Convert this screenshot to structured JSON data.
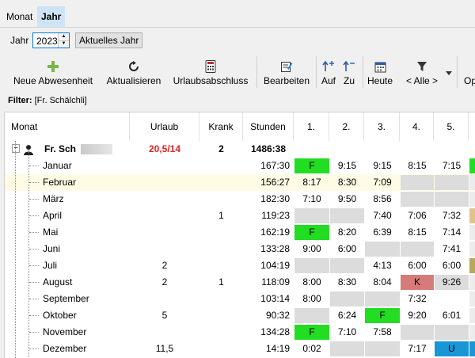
{
  "tabs": [
    {
      "label": "Monat"
    },
    {
      "label": "Jahr"
    }
  ],
  "year": {
    "label": "Jahr",
    "value": "2023",
    "button": "Aktuelles Jahr"
  },
  "toolbar": {
    "neue": "Neue Abwesenheit",
    "aktualisieren": "Aktualisieren",
    "urlaubsabschluss": "Urlaubsabschluss",
    "bearbeiten": "Bearbeiten",
    "auf": "Auf",
    "zu": "Zu",
    "heute": "Heute",
    "alle": "< Alle >",
    "op": "Op"
  },
  "filter": {
    "label": "Filter:",
    "value": "[Fr. Schälchli]"
  },
  "columns": {
    "monat": "Monat",
    "urlaub": "Urlaub",
    "krank": "Krank",
    "stunden": "Stunden",
    "d1": "1.",
    "d2": "2.",
    "d3": "3.",
    "d4": "4.",
    "d5": "5."
  },
  "person": {
    "name": "Fr. Sch",
    "urlaub": "20,5/14",
    "krank": "2",
    "stunden": "1486:38"
  },
  "colors": {
    "urlaub_total": "#e02020",
    "selected_row": "#fffbe4",
    "tab_active": "#cfe3f7"
  },
  "rows": [
    {
      "monat": "Januar",
      "urlaub": "",
      "krank": "",
      "stunden": "167:30",
      "days": [
        {
          "t": "F",
          "c": "green"
        },
        {
          "t": "9:15",
          "c": ""
        },
        {
          "t": "9:15",
          "c": ""
        },
        {
          "t": "8:15",
          "c": ""
        },
        {
          "t": "7:15",
          "c": ""
        }
      ],
      "edge": "green"
    },
    {
      "monat": "Februar",
      "urlaub": "",
      "krank": "",
      "stunden": "156:27",
      "days": [
        {
          "t": "8:17",
          "c": ""
        },
        {
          "t": "8:30",
          "c": ""
        },
        {
          "t": "7:09",
          "c": ""
        },
        {
          "t": "",
          "c": "gray"
        },
        {
          "t": "",
          "c": "gray"
        }
      ],
      "edge": ""
    },
    {
      "monat": "März",
      "urlaub": "",
      "krank": "",
      "stunden": "182:30",
      "days": [
        {
          "t": "7:10",
          "c": ""
        },
        {
          "t": "9:50",
          "c": ""
        },
        {
          "t": "8:56",
          "c": ""
        },
        {
          "t": "",
          "c": "gray"
        },
        {
          "t": "",
          "c": "gray"
        }
      ],
      "edge": ""
    },
    {
      "monat": "April",
      "urlaub": "",
      "krank": "1",
      "stunden": "119:23",
      "days": [
        {
          "t": "",
          "c": "gray"
        },
        {
          "t": "",
          "c": "gray"
        },
        {
          "t": "7:40",
          "c": ""
        },
        {
          "t": "7:06",
          "c": ""
        },
        {
          "t": "7:32",
          "c": ""
        }
      ],
      "edge": "tan"
    },
    {
      "monat": "Mai",
      "urlaub": "",
      "krank": "",
      "stunden": "162:19",
      "days": [
        {
          "t": "F",
          "c": "green"
        },
        {
          "t": "8:20",
          "c": ""
        },
        {
          "t": "6:39",
          "c": ""
        },
        {
          "t": "8:15",
          "c": ""
        },
        {
          "t": "7:14",
          "c": ""
        }
      ],
      "edge": ""
    },
    {
      "monat": "Juni",
      "urlaub": "",
      "krank": "",
      "stunden": "133:28",
      "days": [
        {
          "t": "9:00",
          "c": ""
        },
        {
          "t": "6:00",
          "c": ""
        },
        {
          "t": "",
          "c": "gray"
        },
        {
          "t": "",
          "c": "gray"
        },
        {
          "t": "7:41",
          "c": ""
        }
      ],
      "edge": ""
    },
    {
      "monat": "Juli",
      "urlaub": "2",
      "krank": "",
      "stunden": "104:19",
      "days": [
        {
          "t": "",
          "c": "gray"
        },
        {
          "t": "",
          "c": "gray"
        },
        {
          "t": "4:13",
          "c": ""
        },
        {
          "t": "6:00",
          "c": ""
        },
        {
          "t": "6:00",
          "c": ""
        }
      ],
      "edge": "olive"
    },
    {
      "monat": "August",
      "urlaub": "2",
      "krank": "1",
      "stunden": "118:09",
      "days": [
        {
          "t": "8:00",
          "c": ""
        },
        {
          "t": "8:30",
          "c": ""
        },
        {
          "t": "8:04",
          "c": ""
        },
        {
          "t": "K",
          "c": "pink"
        },
        {
          "t": "9:26",
          "c": "gray"
        }
      ],
      "edge": ""
    },
    {
      "monat": "September",
      "urlaub": "",
      "krank": "",
      "stunden": "103:14",
      "days": [
        {
          "t": "8:00",
          "c": ""
        },
        {
          "t": "",
          "c": "gray"
        },
        {
          "t": "",
          "c": "gray"
        },
        {
          "t": "7:32",
          "c": ""
        },
        {
          "t": "",
          "c": ""
        }
      ],
      "edge": ""
    },
    {
      "monat": "Oktober",
      "urlaub": "5",
      "krank": "",
      "stunden": "90:32",
      "days": [
        {
          "t": "",
          "c": "gray"
        },
        {
          "t": "6:24",
          "c": ""
        },
        {
          "t": "F",
          "c": "green"
        },
        {
          "t": "9:20",
          "c": ""
        },
        {
          "t": "6:01",
          "c": ""
        }
      ],
      "edge": ""
    },
    {
      "monat": "November",
      "urlaub": "",
      "krank": "",
      "stunden": "134:28",
      "days": [
        {
          "t": "F",
          "c": "green"
        },
        {
          "t": "7:10",
          "c": ""
        },
        {
          "t": "7:58",
          "c": ""
        },
        {
          "t": "",
          "c": "gray"
        },
        {
          "t": "",
          "c": "gray"
        }
      ],
      "edge": ""
    },
    {
      "monat": "Dezember",
      "urlaub": "11,5",
      "krank": "",
      "stunden": "14:19",
      "days": [
        {
          "t": "0:02",
          "c": ""
        },
        {
          "t": "",
          "c": "gray"
        },
        {
          "t": "",
          "c": "gray"
        },
        {
          "t": "7:17",
          "c": ""
        },
        {
          "t": "U",
          "c": "blue"
        }
      ],
      "edge": "blue"
    }
  ]
}
